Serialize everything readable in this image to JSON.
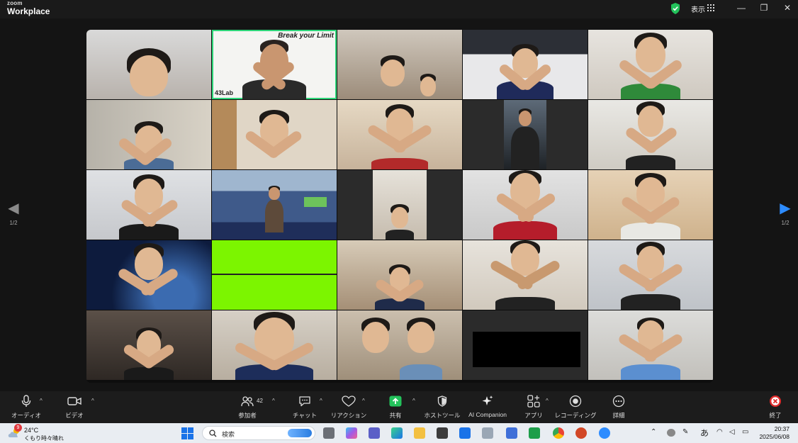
{
  "app": {
    "brand_small": "zoom",
    "brand_name": "Workplace",
    "view_label": "表示"
  },
  "window_controls": {
    "minimize": "—",
    "restore": "❐",
    "close": "✕"
  },
  "gallery": {
    "banner_text": "Break your Limit",
    "logo_text": "43Lab",
    "pager_left": "1/2",
    "pager_right": "1/2"
  },
  "toolbar": {
    "audio": "オーディオ",
    "video": "ビデオ",
    "participants": "参加者",
    "participants_count": "42",
    "chat": "チャット",
    "reactions": "リアクション",
    "share": "共有",
    "host_tools": "ホストツール",
    "ai_companion": "AI Companion",
    "apps": "アプリ",
    "recording": "レコーディング",
    "more": "詳細",
    "end": "終了"
  },
  "taskbar": {
    "weather_badge": "9",
    "temperature": "24°C",
    "condition": "くもり時々晴れ",
    "search_placeholder": "検索",
    "ime": "あ",
    "time": "20:37",
    "date": "2025/06/08"
  },
  "colors": {
    "active_speaker": "#2ed67a",
    "share_green": "#23c25b",
    "end_red": "#e02a2a",
    "virtual_bg_green": "#7cf500"
  }
}
